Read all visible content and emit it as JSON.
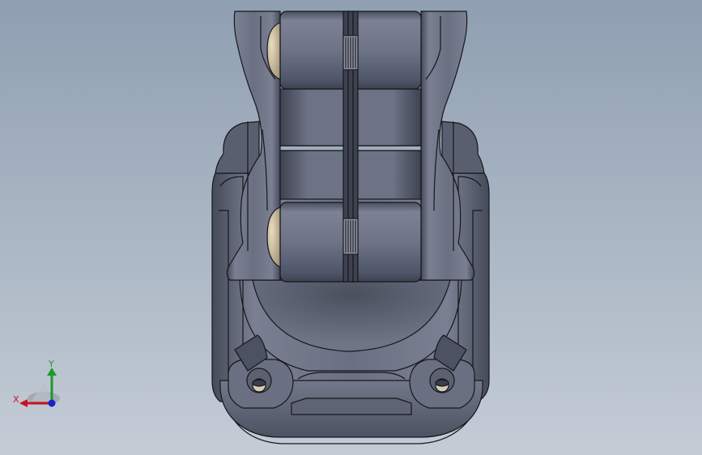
{
  "viewport": {
    "background_top": "#8f9fb1",
    "background_bottom": "#c4ccd6"
  },
  "model": {
    "body_color": "#616779",
    "edge_color": "#15171c",
    "insert_color": "#cfc2a4"
  },
  "triad": {
    "x_label": "X",
    "y_label": "Y",
    "x_color": "#c8141c",
    "y_color": "#1e9a2a",
    "z_color": "#1a22c8"
  }
}
